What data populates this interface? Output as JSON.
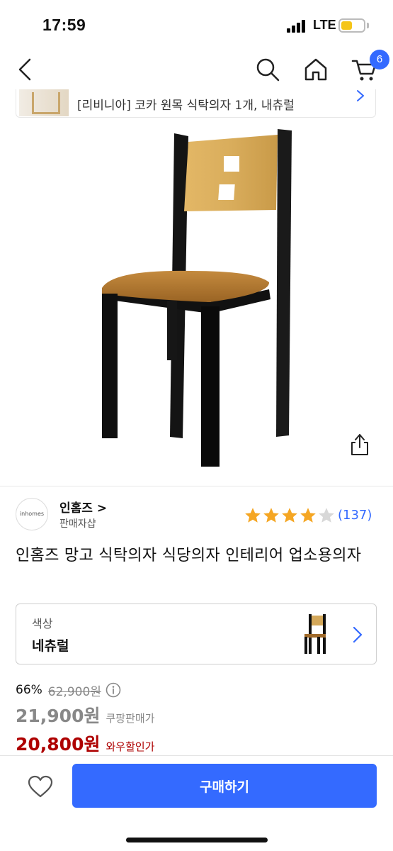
{
  "status": {
    "time": "17:59",
    "network": "LTE"
  },
  "nav": {
    "cart_count": "6"
  },
  "banner": {
    "text": "[리비니아] 코카 원목 식탁의자 1개, 내츄럴"
  },
  "seller": {
    "logo_text": "inhomes",
    "name": "인홈즈 >",
    "subtitle": "판매자샵"
  },
  "rating": {
    "stars": 4,
    "max_stars": 5,
    "count": "(137)"
  },
  "product": {
    "title": "인홈즈 망고 식탁의자 식당의자 인테리어 업소용의자"
  },
  "option": {
    "label": "색상",
    "value": "네츄럴"
  },
  "pricing": {
    "discount": "66%",
    "original_price": "62,900원",
    "sale_price": "21,900원",
    "sale_label": "쿠팡판매가",
    "wow_price": "20,800원",
    "wow_label": "와우할인가"
  },
  "actions": {
    "buy_label": "구매하기"
  },
  "colors": {
    "accent": "#346aff",
    "wow_red": "#ae0000",
    "star": "#f5a623"
  }
}
